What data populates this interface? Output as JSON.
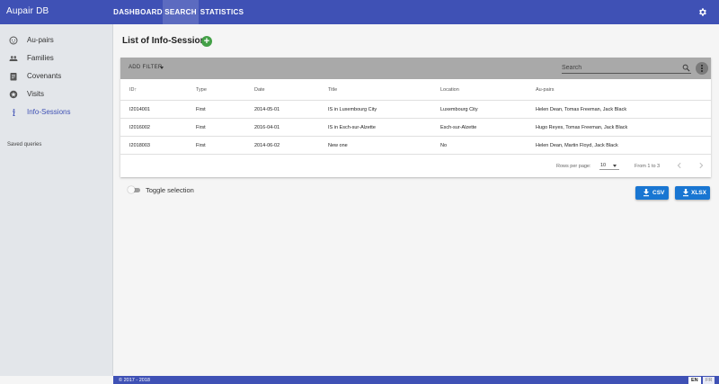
{
  "app": {
    "title": "Aupair DB"
  },
  "nav": {
    "tabs": [
      {
        "label": "DASHBOARD",
        "active": false
      },
      {
        "label": "SEARCH",
        "active": true
      },
      {
        "label": "STATISTICS",
        "active": false
      }
    ],
    "settings_icon": "gear-icon"
  },
  "sidebar": {
    "items": [
      {
        "label": "Au-pairs",
        "icon": "baby-face-icon",
        "active": false
      },
      {
        "label": "Families",
        "icon": "people-icon",
        "active": false
      },
      {
        "label": "Covenants",
        "icon": "clipboard-icon",
        "active": false
      },
      {
        "label": "Visits",
        "icon": "star-badge-icon",
        "active": false
      },
      {
        "label": "Info-Sessions",
        "icon": "info-icon",
        "active": true
      }
    ],
    "saved_queries_label": "Saved queries"
  },
  "main": {
    "title": "List of Info-Sessions",
    "add_icon": "plus",
    "filter": {
      "add_filter_label": "ADD FILTER",
      "search_placeholder": "Search"
    },
    "table": {
      "columns": [
        "ID",
        "Type",
        "Date",
        "Title",
        "Location",
        "Au-pairs"
      ],
      "sort_indicator": "↑",
      "rows": [
        {
          "id": "I2014001",
          "type": "First",
          "date": "2014-05-01",
          "title": "IS in Luxembourg City",
          "location": "Luxembourg City",
          "aupairs": "Helen Dean, Tomas Freeman, Jack Black"
        },
        {
          "id": "I2016002",
          "type": "First",
          "date": "2016-04-01",
          "title": "IS in Esch-sur-Alzette",
          "location": "Esch-sur-Alzette",
          "aupairs": "Hugo Reyes, Tomas Freeman, Jack Black"
        },
        {
          "id": "I2018003",
          "type": "First",
          "date": "2014-06-02",
          "title": "New one",
          "location": "No",
          "aupairs": "Helen Dean, Martin Floyd, Jack Black"
        }
      ]
    },
    "pagination": {
      "rows_per_page_label": "Rows per page:",
      "rows_per_page_value": "10",
      "range_label": "From 1 to 3"
    },
    "toggle_selection_label": "Toggle selection",
    "export": {
      "csv_label": "CSV",
      "xlsx_label": "XLSX"
    }
  },
  "footer": {
    "copyright": "© 2017 - 2018",
    "languages": [
      {
        "code": "EN",
        "active": true
      },
      {
        "code": "FR",
        "active": false
      }
    ]
  },
  "colors": {
    "primary": "#3f51b5",
    "accent_green": "#43a047",
    "button_blue": "#1976d2"
  }
}
